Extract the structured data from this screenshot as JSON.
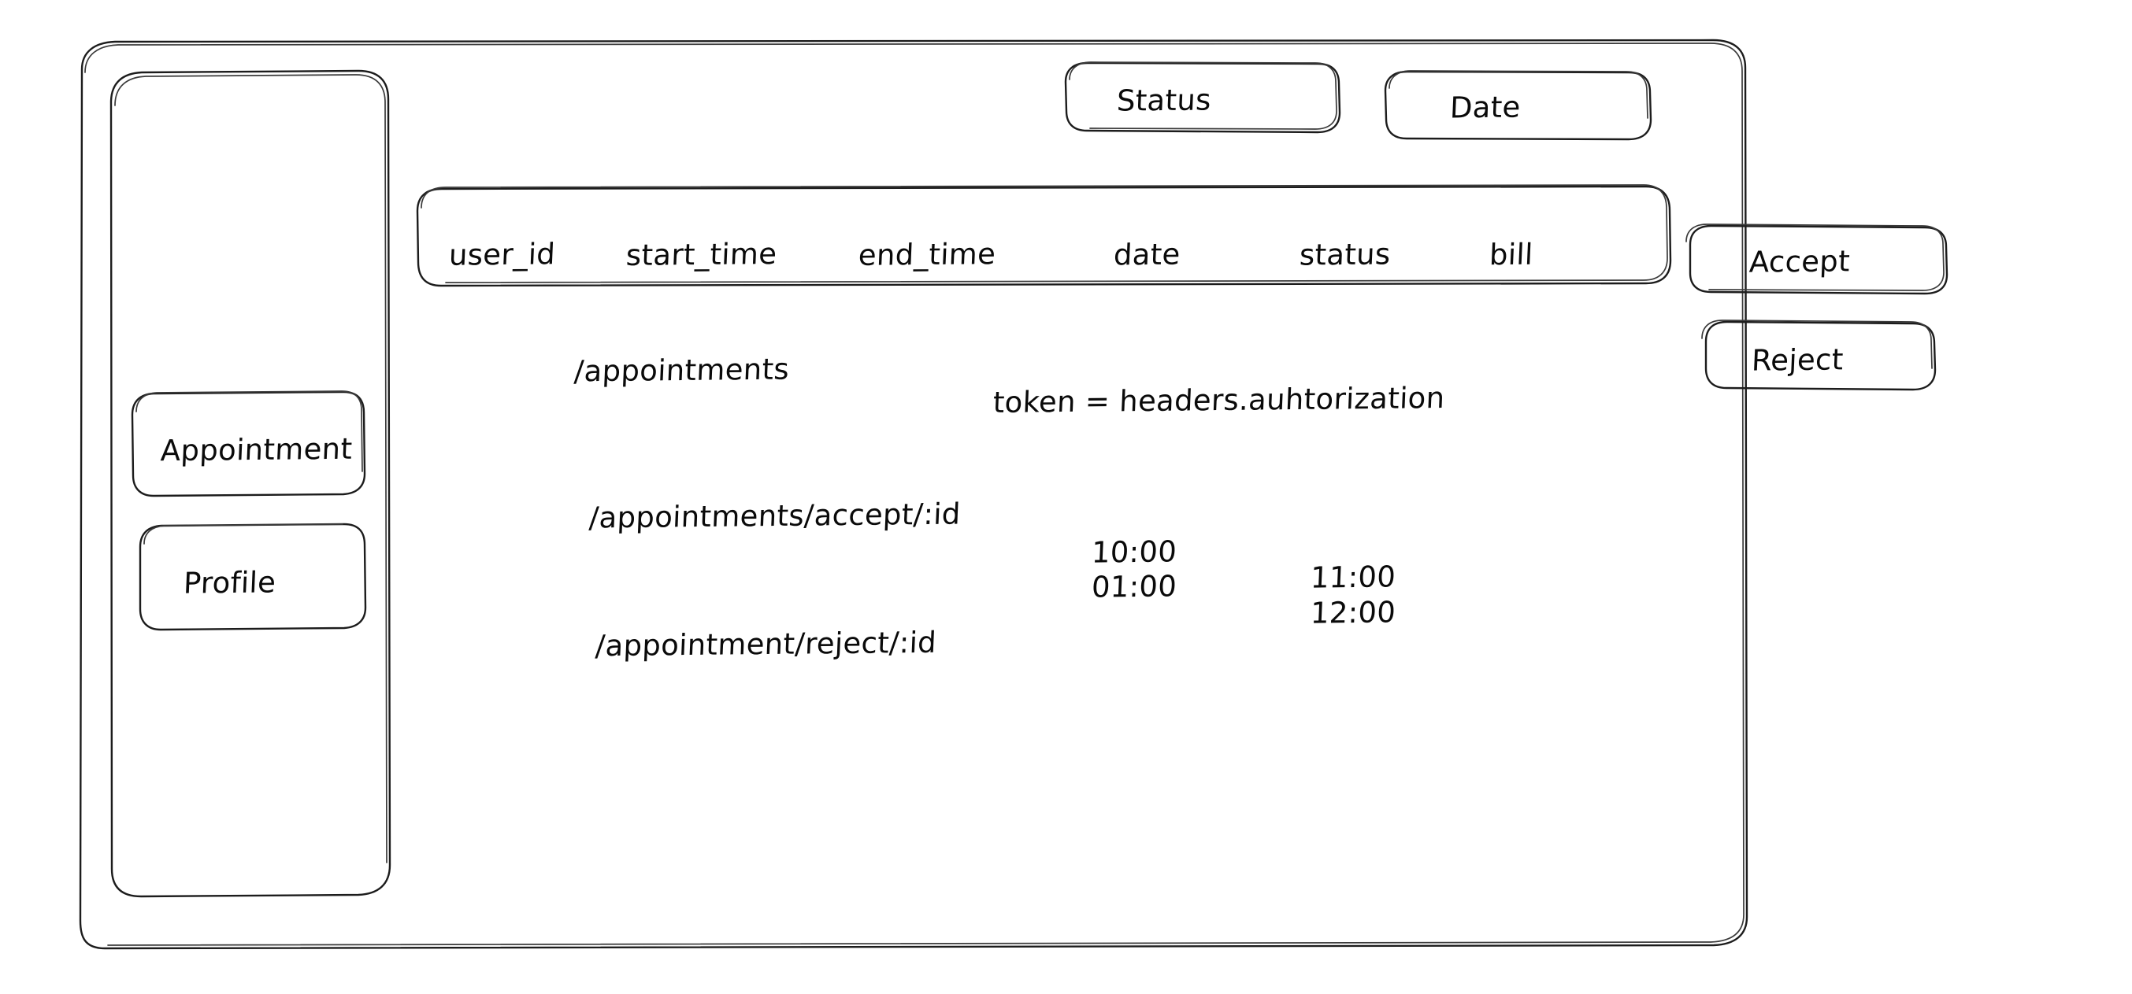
{
  "window": {
    "title": "Appointment dashboard wireframe",
    "frame_color": "#1c1c1c",
    "background": "#ffffff"
  },
  "sidebar": {
    "items": [
      {
        "label": "Appointment"
      },
      {
        "label": "Profile"
      }
    ]
  },
  "filters": [
    {
      "label": "Status"
    },
    {
      "label": "Date"
    }
  ],
  "table": {
    "columns": [
      {
        "label": "user_id"
      },
      {
        "label": "start_time"
      },
      {
        "label": "end_time"
      },
      {
        "label": "date"
      },
      {
        "label": "status"
      },
      {
        "label": "bill"
      }
    ]
  },
  "actions": [
    {
      "label": "Accept"
    },
    {
      "label": "Reject"
    }
  ],
  "notes": {
    "route_list": "/appointments",
    "route_accept": "/appointments/accept/:id",
    "route_reject": "/appointment/reject/:id",
    "token_note": "token = headers.auhtorization"
  },
  "times": {
    "start_column": [
      "10:00",
      "01:00"
    ],
    "end_column": [
      "11:00",
      "12:00"
    ]
  }
}
